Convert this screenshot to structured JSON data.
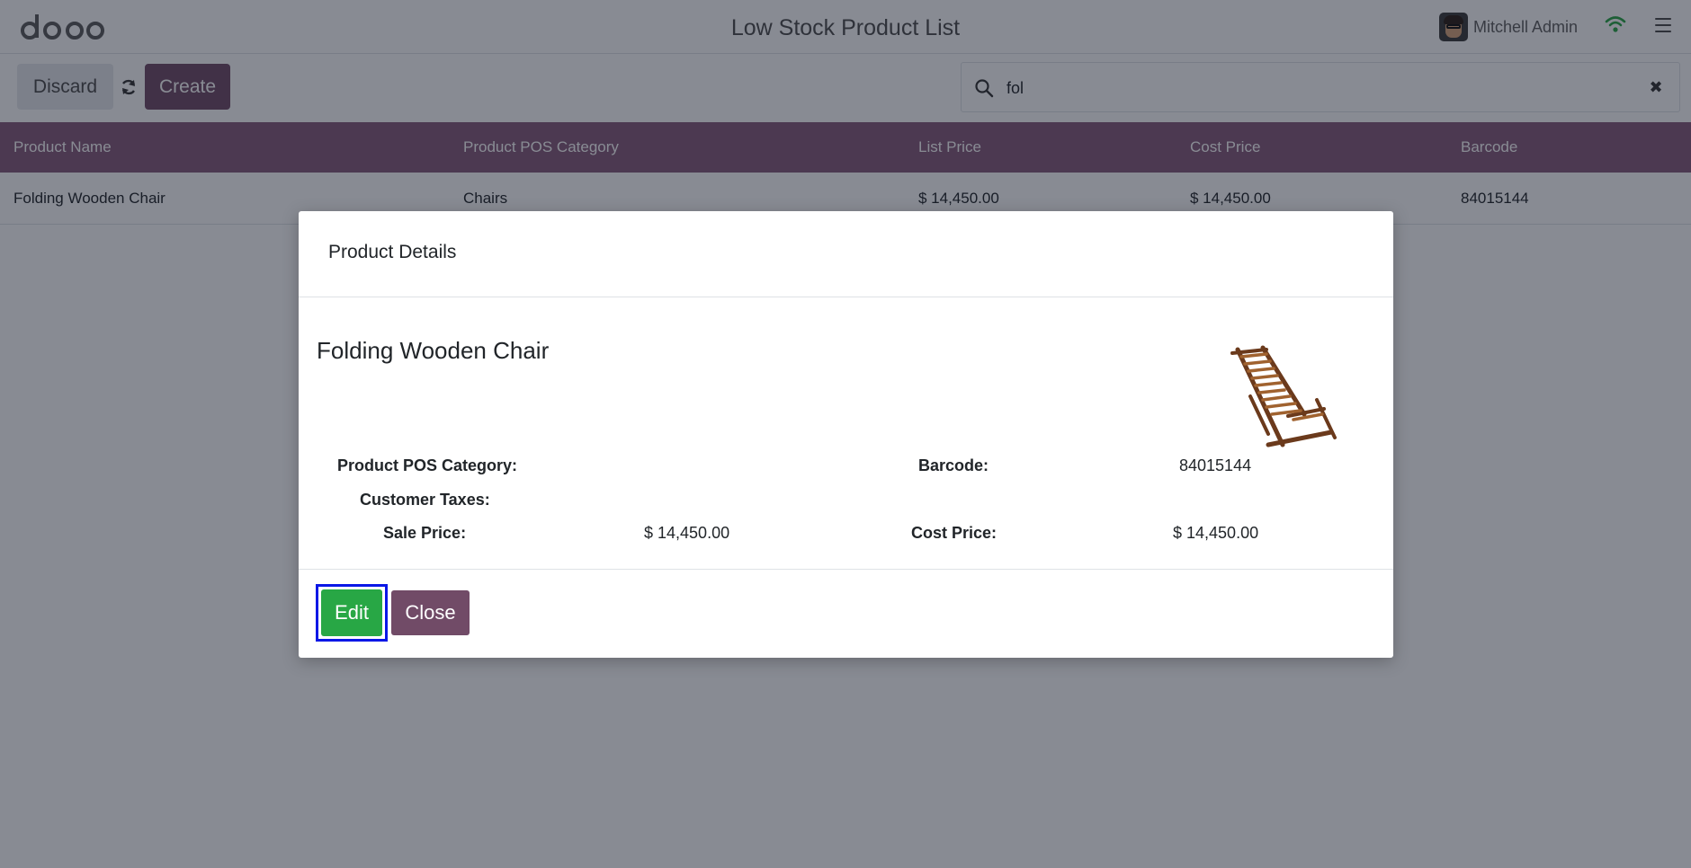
{
  "header": {
    "title": "Low Stock Product List",
    "user_name": "Mitchell Admin",
    "logo_icon": "odoo-logo",
    "wifi_icon": "wifi-icon",
    "menu_icon": "hamburger-menu-icon"
  },
  "controls": {
    "discard_label": "Discard",
    "create_label": "Create",
    "search_value": "fol",
    "clear_symbol": "✖"
  },
  "table": {
    "columns": [
      "Product Name",
      "Product POS Category",
      "List Price",
      "Cost Price",
      "Barcode"
    ],
    "rows": [
      [
        "Folding Wooden Chair",
        "Chairs",
        "$ 14,450.00",
        "$ 14,450.00",
        "84015144"
      ]
    ]
  },
  "modal": {
    "title": "Product Details",
    "product_name": "Folding Wooden Chair",
    "labels": {
      "pos_category": "Product POS Category:",
      "customer_taxes": "Customer Taxes:",
      "sale_price": "Sale Price:",
      "barcode": "Barcode:",
      "cost_price": "Cost Price:"
    },
    "values": {
      "sale_price": "$ 14,450.00",
      "barcode": "84015144",
      "cost_price": "$ 14,450.00"
    },
    "edit_label": "Edit",
    "close_label": "Close"
  },
  "colors": {
    "primary": "#714b67",
    "table_header": "#875a7b",
    "edit_button": "#28a745",
    "highlight_border": "#0a17e6"
  }
}
